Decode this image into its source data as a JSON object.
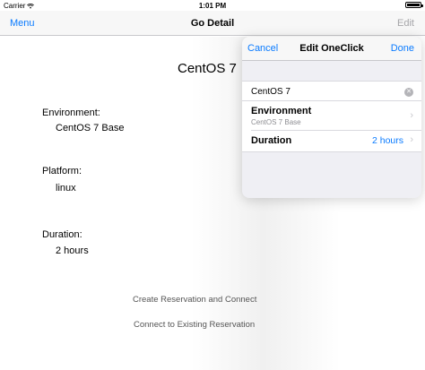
{
  "status_bar": {
    "carrier": "Carrier",
    "time": "1:01 PM",
    "battery_level": 1.0
  },
  "nav": {
    "left": "Menu",
    "title": "Go Detail",
    "right": "Edit"
  },
  "main": {
    "title": "CentOS 7",
    "fields": [
      {
        "label": "Environment:",
        "value": "CentOS 7 Base"
      },
      {
        "label": "Platform:",
        "value": "linux"
      },
      {
        "label": "Duration:",
        "value": "2 hours"
      }
    ],
    "actions": {
      "create": "Create Reservation and Connect",
      "connect": "Connect to Existing Reservation"
    }
  },
  "popover": {
    "cancel": "Cancel",
    "title": "Edit OneClick",
    "done": "Done",
    "name_value": "CentOS 7",
    "environment": {
      "title": "Environment",
      "subtitle": "CentOS 7 Base"
    },
    "duration": {
      "title": "Duration",
      "value": "2 hours"
    }
  },
  "colors": {
    "accent": "#0a7bff",
    "disabled": "#a5a5a8",
    "secondary_text": "#8e8e93"
  },
  "icons": [
    "wifi-icon",
    "battery-icon",
    "clear-icon",
    "chevron-right-icon"
  ]
}
